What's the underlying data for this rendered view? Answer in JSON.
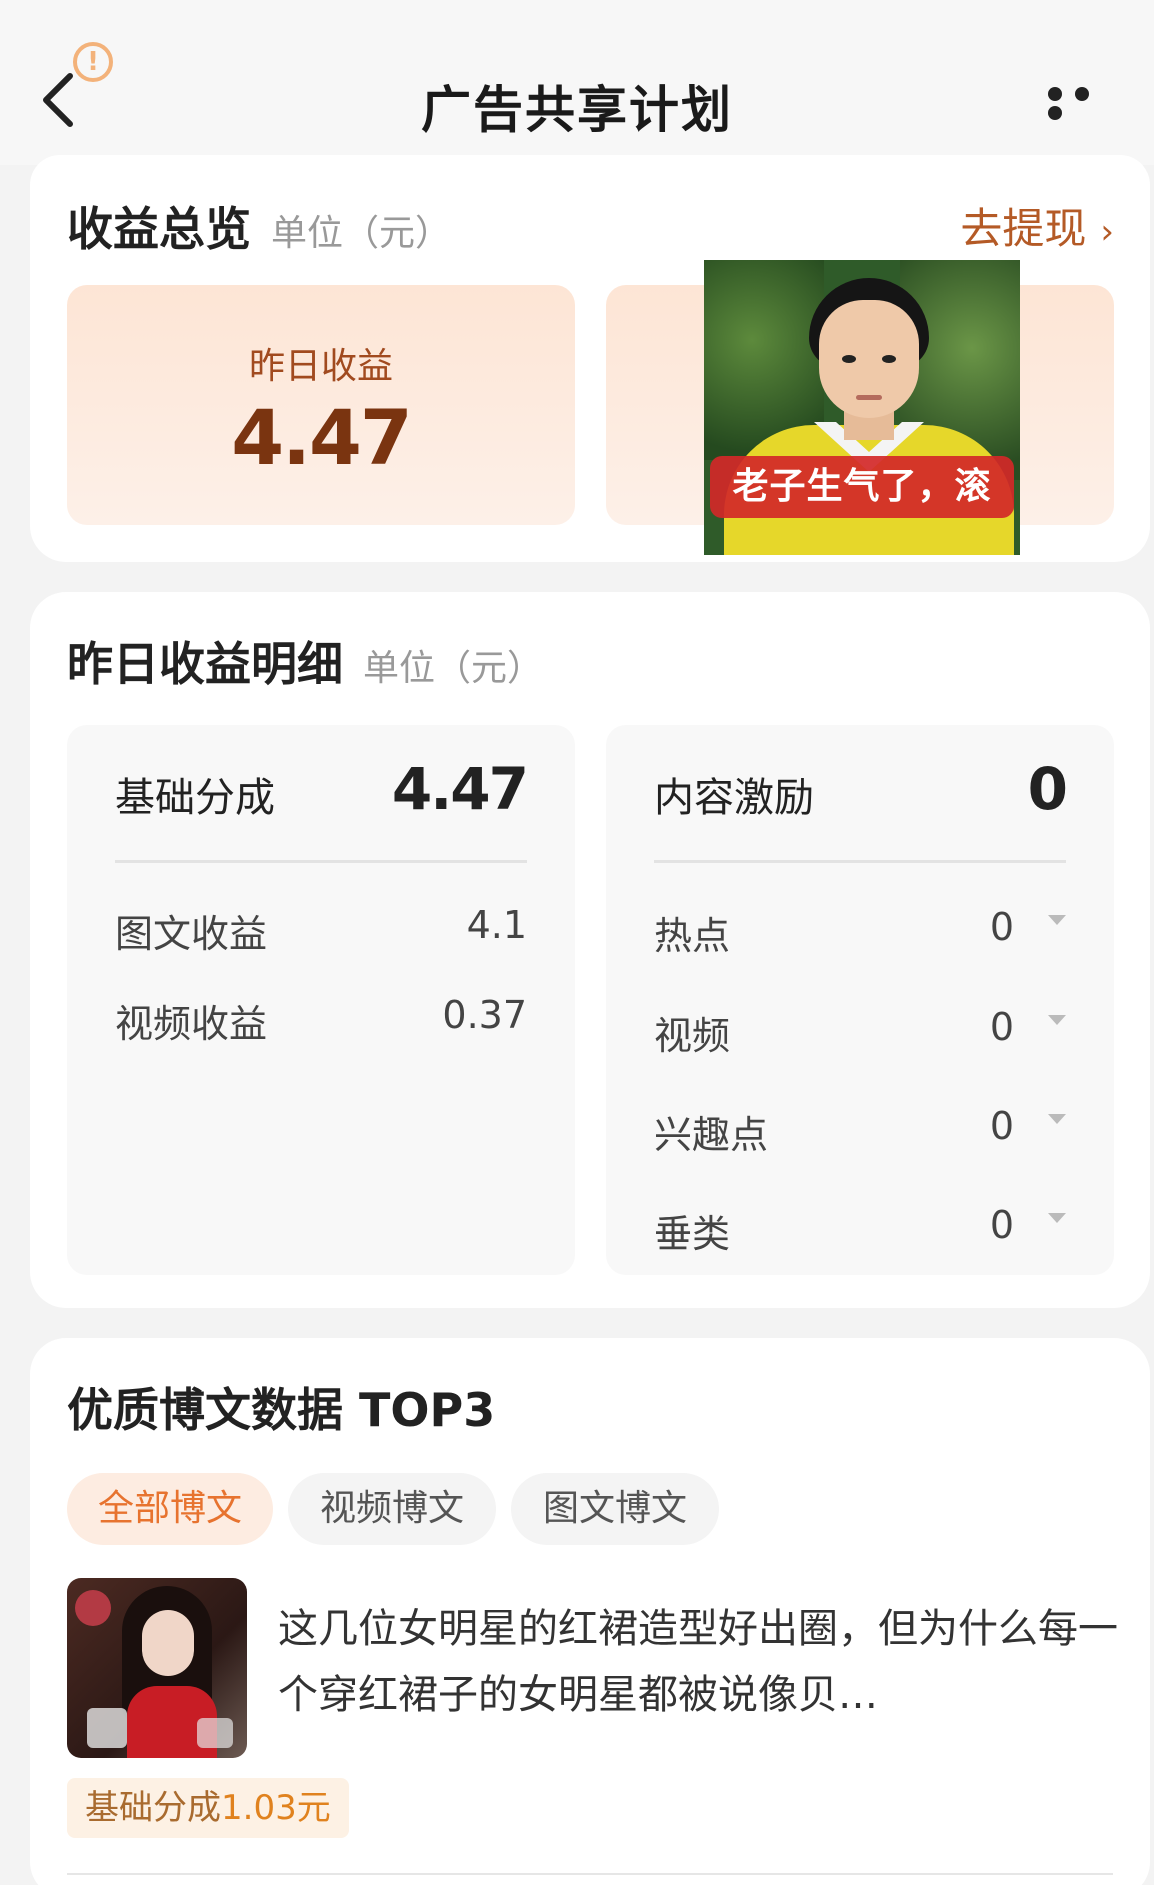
{
  "header": {
    "title": "广告共享计划",
    "alert_glyph": "!"
  },
  "overview": {
    "title": "收益总览",
    "unit": "单位（元）",
    "withdraw_label": "去提现",
    "withdraw_chevron": "›",
    "yesterday_label": "昨日收益",
    "yesterday_value": "4.47",
    "meme_caption": "老子生气了，滚"
  },
  "detail": {
    "title": "昨日收益明细",
    "unit": "单位（元）",
    "base": {
      "label": "基础分成",
      "value": "4.47",
      "rows": [
        {
          "label": "图文收益",
          "value": "4.1"
        },
        {
          "label": "视频收益",
          "value": "0.37"
        }
      ]
    },
    "incentive": {
      "label": "内容激励",
      "value": "0",
      "rows": [
        {
          "label": "热点",
          "value": "0"
        },
        {
          "label": "视频",
          "value": "0"
        },
        {
          "label": "兴趣点",
          "value": "0"
        },
        {
          "label": "垂类",
          "value": "0"
        }
      ]
    }
  },
  "top3": {
    "title": "优质博文数据 TOP3",
    "tabs": [
      {
        "label": "全部博文",
        "active": true
      },
      {
        "label": "视频博文",
        "active": false
      },
      {
        "label": "图文博文",
        "active": false
      }
    ],
    "posts": [
      {
        "title": "这几位女明星的红裙造型好出圈，但为什么每一个穿红裙子的女明星都被说像贝…",
        "badge_label": "基础分成",
        "badge_value": "1.03元"
      }
    ]
  },
  "colors": {
    "accent": "#e7732f",
    "brand_brown": "#7a3410",
    "withdraw": "#b45a26"
  },
  "icons": [
    "back-arrow-icon",
    "alert-circle-icon",
    "more-dots-icon",
    "chevron-right-icon",
    "dropdown-triangle-icon"
  ]
}
